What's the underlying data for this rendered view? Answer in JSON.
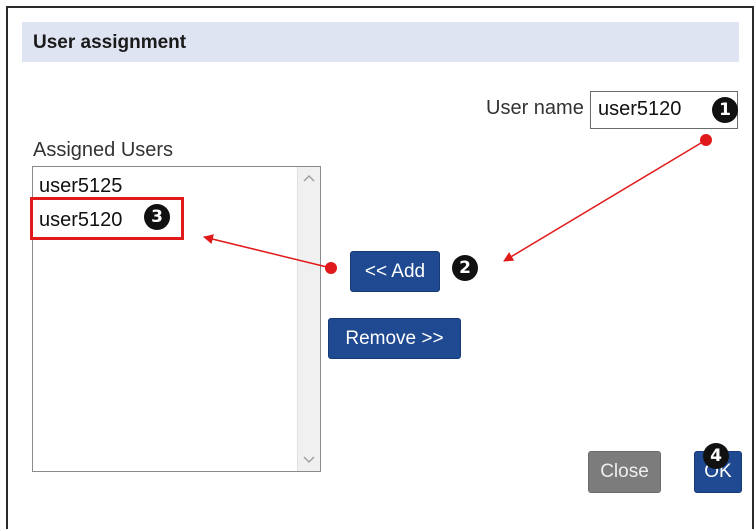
{
  "dialog": {
    "title": "User assignment",
    "username": {
      "label": "User name",
      "value": "user5120"
    },
    "assigned": {
      "label": "Assigned Users",
      "items": [
        "user5125",
        "user5120"
      ]
    },
    "buttons": {
      "add": "<< Add",
      "remove": "Remove >>",
      "close": "Close",
      "ok": "OK"
    }
  },
  "annotations": {
    "badge_1": "1",
    "badge_2": "2",
    "badge_3": "3",
    "badge_4": "4"
  },
  "colors": {
    "accent_button": "#1f4a91",
    "disabled_button": "#7c7c7c",
    "annotation_red": "#e01a1a",
    "title_bar": "#dfe4f3"
  },
  "icons": {
    "scroll_up": "chevron-up-icon",
    "scroll_down": "chevron-down-icon"
  }
}
